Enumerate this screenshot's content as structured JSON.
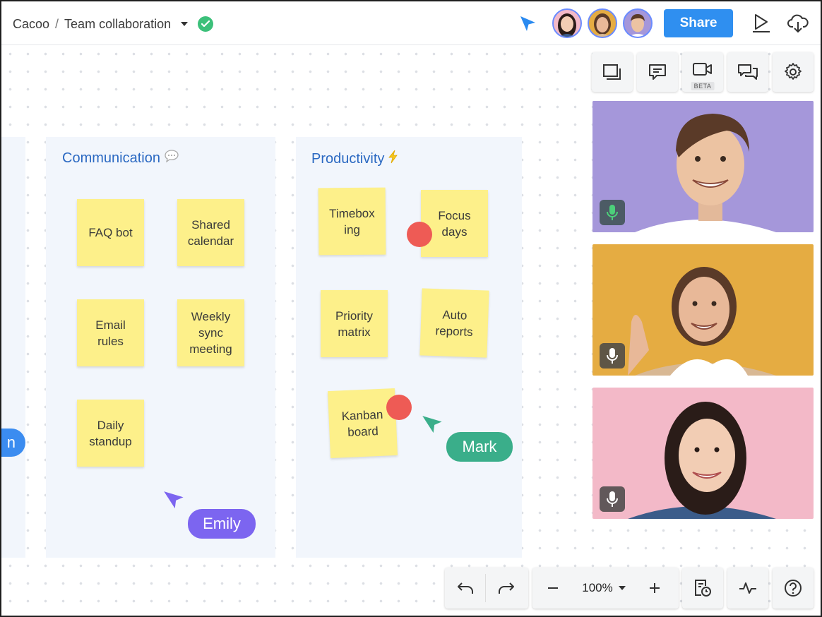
{
  "header": {
    "app_name": "Cacoo",
    "separator": "/",
    "doc_title": "Team collaboration",
    "share_label": "Share"
  },
  "columns": [
    {
      "title": "Communication",
      "notes": [
        "FAQ bot",
        "Shared calendar",
        "Email rules",
        "Weekly sync meeting",
        "Daily standup"
      ]
    },
    {
      "title": "Productivity",
      "notes": [
        "Timebox ing",
        "Focus days",
        "Priority matrix",
        "Auto reports",
        "Kanban board"
      ]
    }
  ],
  "notes": {
    "faq": "FAQ bot",
    "shared_1": "Shared",
    "shared_2": "calendar",
    "email_1": "Email",
    "email_2": "rules",
    "weekly_1": "Weekly",
    "weekly_2": "sync",
    "weekly_3": "meeting",
    "daily_1": "Daily",
    "daily_2": "standup",
    "timebox_1": "Timebox",
    "timebox_2": "ing",
    "focus_1": "Focus",
    "focus_2": "days",
    "priority_1": "Priority",
    "priority_2": "matrix",
    "auto_1": "Auto",
    "auto_2": "reports",
    "kanban_1": "Kanban",
    "kanban_2": "board"
  },
  "cursors": {
    "mark": "Mark",
    "emily": "Emily",
    "offscreen_fragment": "n"
  },
  "toolbar": {
    "video_badge": "BETA"
  },
  "zoom": {
    "level": "100%"
  },
  "colors": {
    "accent": "#2f8ff0",
    "column_bg": "#f2f6fc",
    "sticky": "#fdf08a",
    "dot": "#ee5b55",
    "mark_cursor": "#3aae8a",
    "emily_cursor": "#7c65f0",
    "blue_cursor": "#3b8cf0"
  }
}
